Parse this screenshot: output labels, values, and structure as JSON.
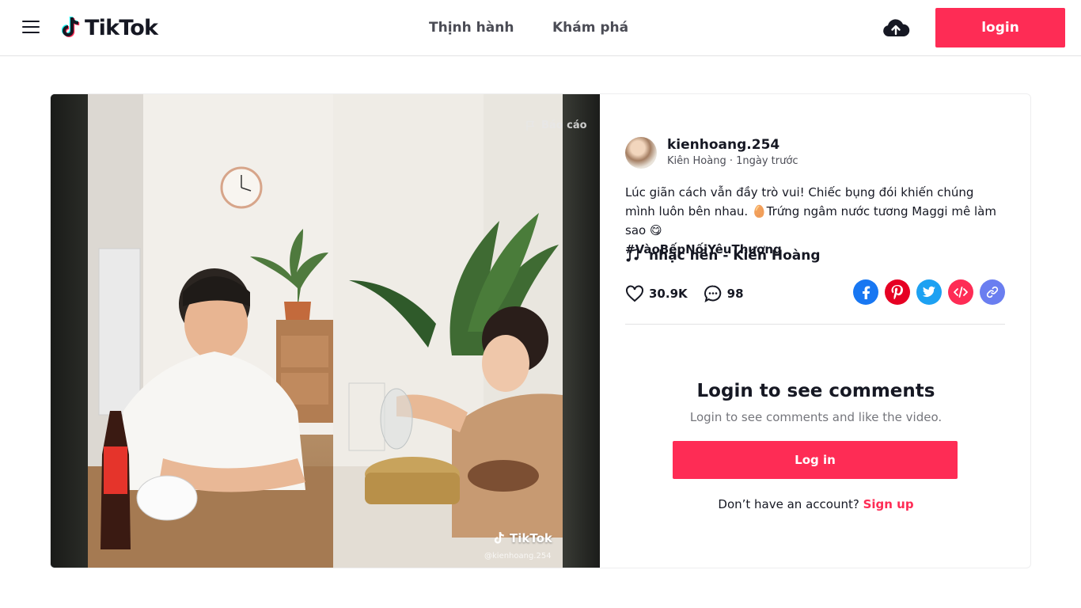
{
  "header": {
    "logo_text": "TikTok",
    "nav": [
      {
        "label": "Thịnh hành"
      },
      {
        "label": "Khám phá"
      }
    ],
    "login_label": "login"
  },
  "video": {
    "report_label": "Báo cáo",
    "watermark": "TikTok",
    "watermark_handle": "@kienhoang.254"
  },
  "author": {
    "username": "kienhoang.254",
    "display_name": "Kiên Hoàng",
    "separator": "·",
    "posted": "1ngày trước"
  },
  "description": {
    "text": "Lúc giãn cách vẫn đầy trò vui! Chiếc bụng đói khiến chúng mình luôn bên nhau. 🥚Trứng ngâm nước tương Maggi mê làm sao 😋",
    "hashtag": "#VàoBếpNốiYêuThương"
  },
  "music": {
    "label": "nhạc nền - Kiên Hoàng"
  },
  "stats": {
    "likes": "30.9K",
    "comments": "98"
  },
  "share": {
    "icons": [
      "facebook-icon",
      "pinterest-icon",
      "twitter-icon",
      "embed-icon",
      "copy-link-icon"
    ]
  },
  "comments": {
    "title": "Login to see comments",
    "subtitle": "Login to see comments and like the video.",
    "login_button": "Log in",
    "no_account": "Don’t have an account?",
    "signup_link": "Sign up"
  },
  "colors": {
    "brand": "#fe2c55",
    "text_primary": "#161823",
    "text_secondary": "#75767c",
    "facebook": "#1877f2",
    "pinterest": "#e60023",
    "twitter": "#1da1f2",
    "embed": "#fe2c55",
    "copy_link": "#6a7ef0"
  }
}
